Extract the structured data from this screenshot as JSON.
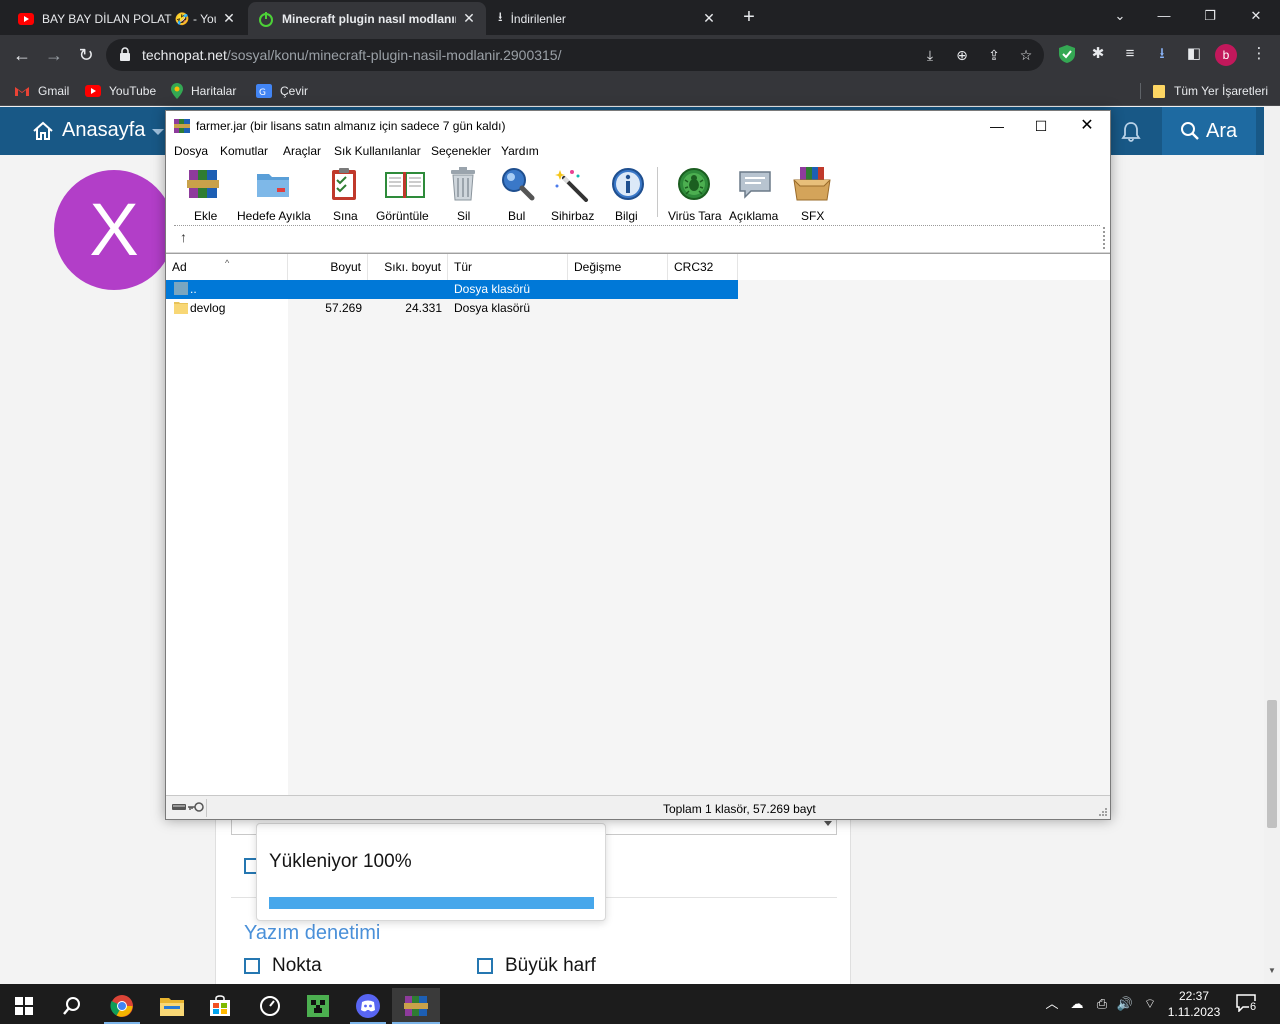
{
  "browser": {
    "tabs": [
      {
        "title": "BAY BAY DİLAN POLAT 🤣 - You",
        "close": "✕",
        "active": false
      },
      {
        "title": "Minecraft plugin nasıl modlanır?",
        "close": "✕",
        "active": true
      },
      {
        "title": "İndirilenler",
        "close": "✕",
        "active": false
      }
    ],
    "new_tab": "+",
    "window_controls": {
      "minimize": "—",
      "restore": "❐",
      "close": "✕"
    },
    "url_host": "technopat.net",
    "url_path": "/sosyal/konu/minecraft-plugin-nasil-modlanir.2900315/",
    "profile_initial": "b",
    "bookmarks": [
      {
        "label": "Gmail",
        "color": "#ea4335"
      },
      {
        "label": "YouTube",
        "color": "#ff0000"
      },
      {
        "label": "Haritalar",
        "color": "#34a853"
      },
      {
        "label": "Çevir",
        "color": "#4285f4"
      }
    ],
    "all_bookmarks": "Tüm Yer İşaretleri"
  },
  "site": {
    "home_label": "Anasayfa",
    "search_label": "Ara",
    "avatar_letter": "X",
    "spell_title": "Yazım denetimi",
    "checkbox_nokta": "Nokta",
    "checkbox_buyuk": "Büyük harf",
    "accent_color": "#185886"
  },
  "loading": {
    "text": "Yükleniyor 100%",
    "progress_fraction": 1.0
  },
  "winrar": {
    "title": "farmer.jar (bir lisans satın almanız için sadece 7 gün kaldı)",
    "menu": [
      "Dosya",
      "Komutlar",
      "Araçlar",
      "Sık Kullanılanlar",
      "Seçenekler",
      "Yardım"
    ],
    "tools": [
      {
        "label": "Ekle",
        "icon": "add-archive-icon"
      },
      {
        "label": "Hedefe Ayıkla",
        "icon": "extract-folder-icon"
      },
      {
        "label": "Sına",
        "icon": "test-clipboard-icon"
      },
      {
        "label": "Görüntüle",
        "icon": "view-book-icon"
      },
      {
        "label": "Sil",
        "icon": "trash-icon"
      },
      {
        "label": "Bul",
        "icon": "find-magnifier-icon"
      },
      {
        "label": "Sihirbaz",
        "icon": "wizard-wand-icon"
      },
      {
        "label": "Bilgi",
        "icon": "info-icon"
      },
      {
        "label": "Virüs Tara",
        "icon": "virus-scan-icon"
      },
      {
        "label": "Açıklama",
        "icon": "comment-icon"
      },
      {
        "label": "SFX",
        "icon": "sfx-box-icon"
      }
    ],
    "columns": [
      "Ad",
      "Boyut",
      "Sıkı. boyut",
      "Tür",
      "Değişme",
      "CRC32"
    ],
    "rows": [
      {
        "name": "..",
        "size": "",
        "packed": "",
        "type": "Dosya klasörü",
        "modified": "",
        "crc": "",
        "selected": true
      },
      {
        "name": "devlog",
        "size": "57.269",
        "packed": "24.331",
        "type": "Dosya klasörü",
        "modified": "",
        "crc": "",
        "selected": false
      }
    ],
    "status": "Toplam 1 klasör, 57.269 bayt"
  },
  "taskbar": {
    "time": "22:37",
    "date": "1.11.2023",
    "notifications": "6"
  }
}
